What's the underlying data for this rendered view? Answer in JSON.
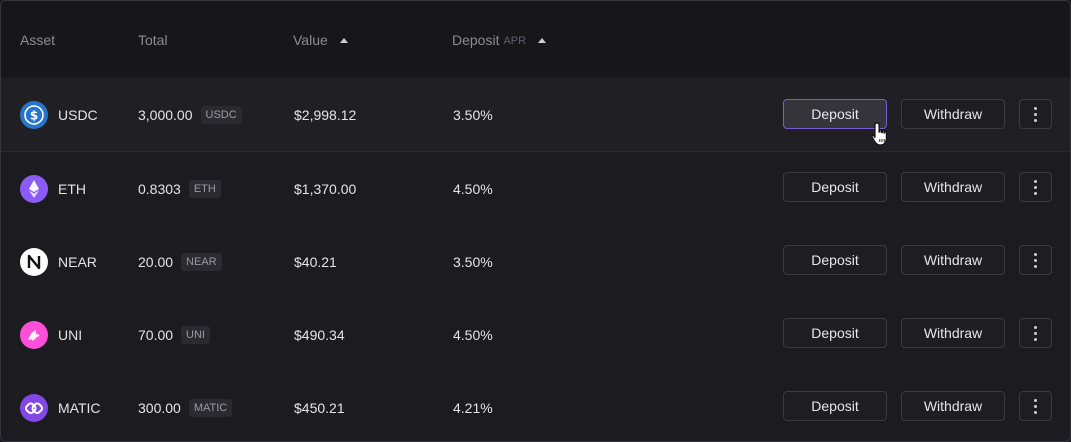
{
  "table": {
    "headers": {
      "asset": "Asset",
      "total": "Total",
      "value": "Value",
      "deposit": "Deposit",
      "deposit_sub": "APR"
    },
    "rows": [
      {
        "asset": "USDC",
        "amount": "3,000.00",
        "unit": "USDC",
        "value": "$2,998.12",
        "apr": "3.50%",
        "icon": "usdc-icon",
        "deposit_label": "Deposit",
        "withdraw_label": "Withdraw"
      },
      {
        "asset": "ETH",
        "amount": "0.8303",
        "unit": "ETH",
        "value": "$1,370.00",
        "apr": "4.50%",
        "icon": "eth-icon",
        "deposit_label": "Deposit",
        "withdraw_label": "Withdraw"
      },
      {
        "asset": "NEAR",
        "amount": "20.00",
        "unit": "NEAR",
        "value": "$40.21",
        "apr": "3.50%",
        "icon": "near-icon",
        "deposit_label": "Deposit",
        "withdraw_label": "Withdraw"
      },
      {
        "asset": "UNI",
        "amount": "70.00",
        "unit": "UNI",
        "value": "$490.34",
        "apr": "4.50%",
        "icon": "uni-icon",
        "deposit_label": "Deposit",
        "withdraw_label": "Withdraw"
      },
      {
        "asset": "MATIC",
        "amount": "300.00",
        "unit": "MATIC",
        "value": "$450.21",
        "apr": "4.21%",
        "icon": "matic-icon",
        "deposit_label": "Deposit",
        "withdraw_label": "Withdraw"
      }
    ]
  },
  "colors": {
    "background": "#1c1c20",
    "header_bg": "#17171a",
    "active_border": "#7c5cd6",
    "usdc": "#2775ca",
    "eth": "#8a5cf5",
    "near": "#ffffff",
    "uni": "#ff4fd8",
    "matic": "#8247e5"
  }
}
